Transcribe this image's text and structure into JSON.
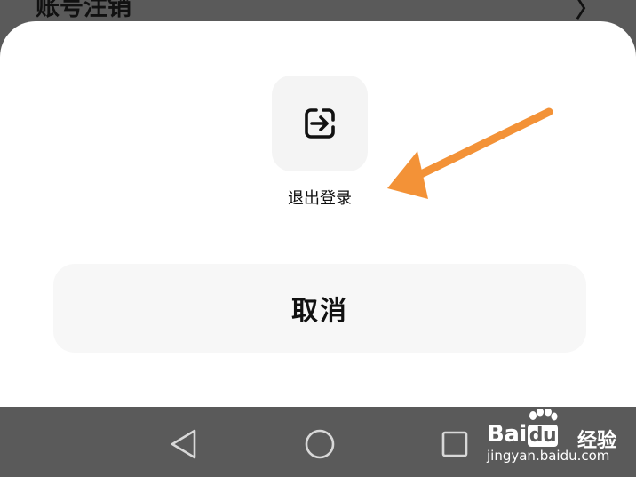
{
  "background_row": {
    "label": "账号注销",
    "chevron": "〉"
  },
  "sheet": {
    "logout": {
      "icon": "logout-icon",
      "label": "退出登录"
    },
    "cancel_label": "取消"
  },
  "annotation": {
    "arrow_color": "#f39237"
  },
  "navbar": {
    "back_icon": "triangle-back-icon",
    "home_icon": "circle-home-icon",
    "recents_icon": "square-recents-icon"
  },
  "watermark": {
    "logo_prefix": "Bai",
    "logo_box": "du",
    "logo_suffix": "经验",
    "url": "jingyan.baidu.com"
  }
}
